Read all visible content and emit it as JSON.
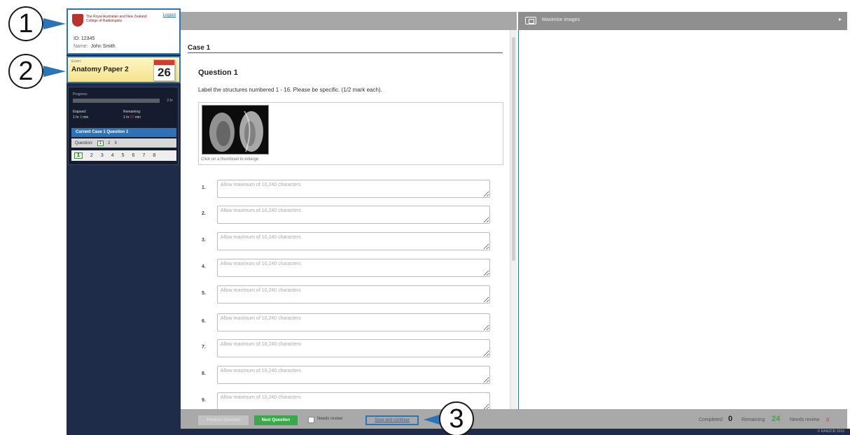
{
  "callouts": [
    "1",
    "2",
    "3"
  ],
  "candidate": {
    "college": "The Royal Australian and New Zealand College of Radiologists",
    "logout": "Logout",
    "id_line": "ID: 12345",
    "name_label": "Name:",
    "name_value": "John Smith"
  },
  "exam": {
    "label": "Exam:",
    "name": "Anatomy Paper 2",
    "day": "26"
  },
  "progress": {
    "label": "Progress:",
    "fraction_complete": 0.0,
    "total": "2 hr",
    "elapsed_label": "Elapsed:",
    "elapsed_prefix": "1 hr",
    "elapsed_min": "3",
    "elapsed_suffix": "min",
    "remaining_label": "Remaining:",
    "remaining_prefix": "1 hr",
    "remaining_min": "57",
    "remaining_suffix": "min",
    "current": "Current Case 1 Question 1",
    "question_label": "Question:",
    "question_numbers": [
      "1",
      "2",
      "3"
    ],
    "case_numbers": [
      "1",
      "2",
      "3",
      "4",
      "5",
      "6",
      "7",
      "8"
    ]
  },
  "question": {
    "case_title": "Case 1",
    "title": "Question 1",
    "instruction": "Label the structures numbered 1 - 16. Please be specific. (1/2 mark each).",
    "image_caption": "Click on a thumbnail to enlarge",
    "answer_placeholder": "Allow maximum of 10,240 characters",
    "answers": [
      "1.",
      "2.",
      "3.",
      "4.",
      "5.",
      "6.",
      "7.",
      "8.",
      "9."
    ]
  },
  "image_pane": {
    "maximise_label": "Maximise images",
    "arrow": "▸"
  },
  "toolbar": {
    "prev_label": "Previous Question",
    "next_label": "Next Question",
    "review_label": "Needs review",
    "save_label": "Save and continue",
    "completed_label": "Completed",
    "completed_value": "0",
    "remaining_label": "Remaining",
    "remaining_value": "24",
    "needs_review_label": "Needs review",
    "needs_review_value": "0"
  },
  "footer": {
    "copyright": "© RANZCR 2016"
  },
  "colors": {
    "sidebar": "#1e2b49",
    "accent_blue": "#2b74b8",
    "next_green": "#3aa84a",
    "alert_red": "#e54e3f"
  }
}
